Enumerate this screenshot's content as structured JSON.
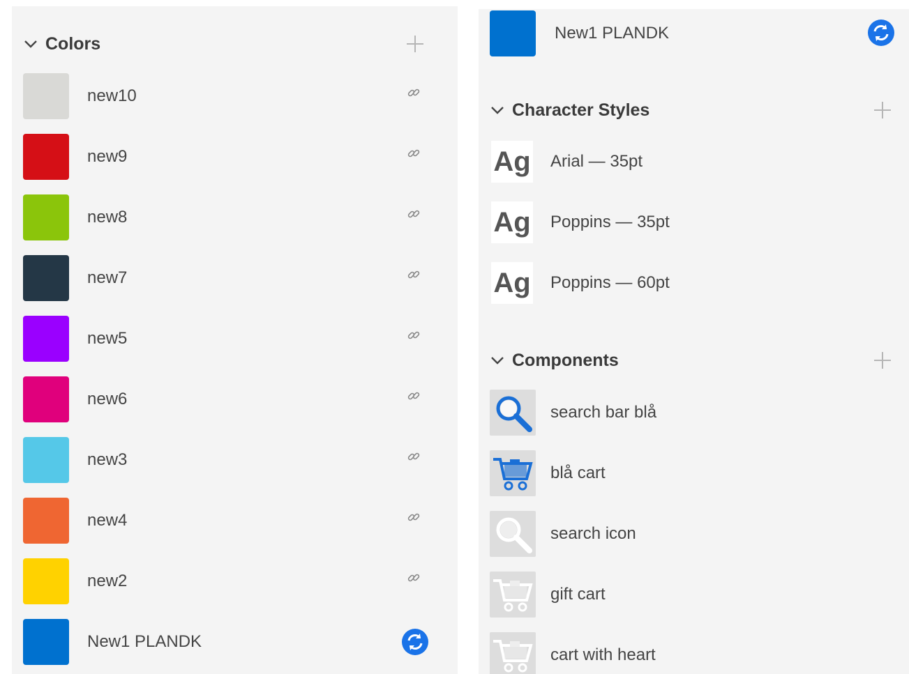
{
  "colors_section": {
    "title": "Colors",
    "items": [
      {
        "label": "new10",
        "color": "#d9d9d6"
      },
      {
        "label": "new9",
        "color": "#d50f16"
      },
      {
        "label": "new8",
        "color": "#8bc50b"
      },
      {
        "label": "new7",
        "color": "#243746"
      },
      {
        "label": "new5",
        "color": "#9a00ff"
      },
      {
        "label": "new6",
        "color": "#e0007c"
      },
      {
        "label": "new3",
        "color": "#55c8e8"
      },
      {
        "label": "new4",
        "color": "#ef6632"
      },
      {
        "label": "new2",
        "color": "#ffd200"
      },
      {
        "label": "New1 PLANDK",
        "color": "#0071cf"
      }
    ]
  },
  "right_top_item": {
    "label": "New1 PLANDK",
    "color": "#0071cf"
  },
  "character_styles": {
    "title": "Character Styles",
    "sample_glyph": "Ag",
    "items": [
      {
        "label": "Arial — 35pt"
      },
      {
        "label": "Poppins — 35pt"
      },
      {
        "label": "Poppins — 60pt"
      }
    ]
  },
  "components": {
    "title": "Components",
    "items": [
      {
        "label": "search bar blå",
        "icon": "magnifier-icon"
      },
      {
        "label": "blå cart",
        "icon": "cart-icon"
      },
      {
        "label": "search icon",
        "icon": "magnifier-icon"
      },
      {
        "label": "gift cart",
        "icon": "cart-icon"
      },
      {
        "label": "cart with heart",
        "icon": "cart-icon"
      }
    ]
  },
  "theme": {
    "accent": "#0071cf",
    "panel_bg": "#f4f4f4",
    "icon_gray": "#bbbbbb"
  }
}
